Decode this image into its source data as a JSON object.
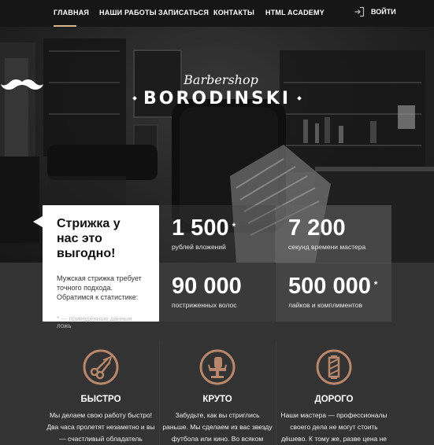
{
  "nav": {
    "items": [
      {
        "label": "ГЛАВНАЯ",
        "active": true
      },
      {
        "label": "НАШИ РАБОТЫ",
        "active": false
      },
      {
        "label": "ЗАПИСАТЬСЯ",
        "active": false
      },
      {
        "label": "КОНТАКТЫ",
        "active": false
      },
      {
        "label": "HTML ACADEMY",
        "active": false
      }
    ],
    "login_label": "ВОЙТИ",
    "login_icon": "login-icon",
    "accent_color": "#d9b38c"
  },
  "hero": {
    "brand_script": "Barbershop",
    "brand_name": "BORODINSKI",
    "logo_icon": "mustache-icon"
  },
  "stats": {
    "title": "Стрижка у нас это выгодно!",
    "description": "Мужская стрижка требует точного подхода. Обратимся к статистике:",
    "note": "* — приведённые данные ложь",
    "items": [
      {
        "value": "1 500",
        "star": "*",
        "label": "рублей вложений"
      },
      {
        "value": "7 200",
        "star": "",
        "label": "секунд времени мастера"
      },
      {
        "value": "90 000",
        "star": "",
        "label": "постриженных волос"
      },
      {
        "value": "500 000",
        "star": "*",
        "label": "лайков и комплиментов"
      }
    ]
  },
  "features": [
    {
      "icon": "scissors-razor-icon",
      "title": "БЫСТРО",
      "text": "Мы делаем свою работу быстро! Два часа пролетят незаметно и вы — счастливый обладатель стильной стрижки-минутки!"
    },
    {
      "icon": "barber-chair-icon",
      "title": "КРУТО",
      "text": "Забудьте, как вы стриглись раньше. Мы сделаем из вас звезду футбола или кино. Во всяком случае внешне."
    },
    {
      "icon": "barber-pole-icon",
      "title": "ДОРОГО",
      "text": "Наши мастера — профессионалы своего дела не могут стоить дёшево. К тому же, разве цена не лучший показатель качества?"
    }
  ]
}
